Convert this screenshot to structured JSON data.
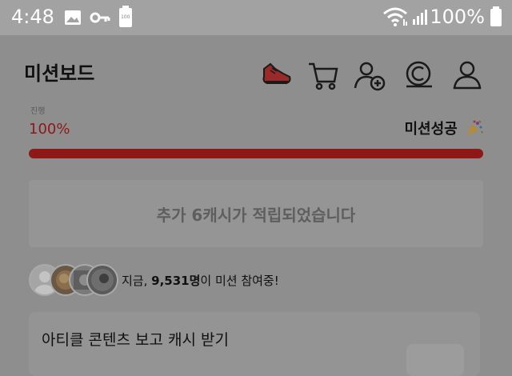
{
  "status_bar": {
    "time": "4:48",
    "battery_percent": "100%",
    "battery_badge": "100"
  },
  "header": {
    "title": "미션보드"
  },
  "progress": {
    "label": "진행",
    "percent_text": "100%",
    "fill": 1.0,
    "mission_status": "미션성공",
    "colors": {
      "fill": "#8e1818",
      "text": "#8e1818"
    }
  },
  "notice": {
    "message": "추가 6캐시가 적립되었습니다"
  },
  "participants": {
    "prefix": "지금, ",
    "count": "9,531명",
    "suffix": "이 미션 참여중!"
  },
  "card": {
    "title": "아티클 콘텐츠 보고 캐시 받기"
  }
}
